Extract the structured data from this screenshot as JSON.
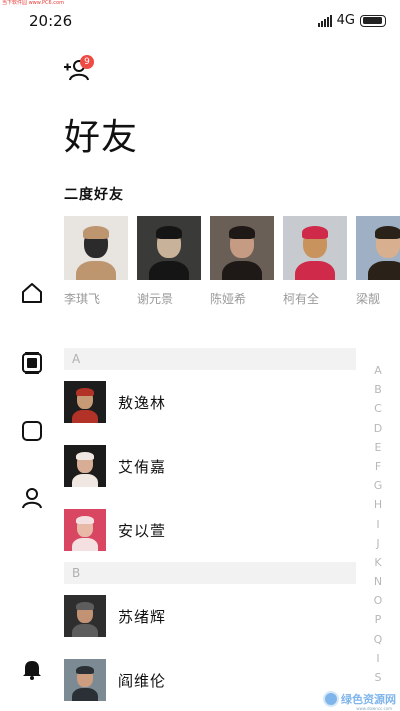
{
  "watermark_top": "当下软件园 www.PC6.com",
  "status_bar": {
    "time": "20:26",
    "network": "4G",
    "network_sub": "ℹ",
    "battery_level": 0.95
  },
  "header": {
    "add_friend_icon": "add-person-icon",
    "badge_count": "9",
    "title": "好友"
  },
  "second_degree": {
    "title": "二度好友",
    "people": [
      {
        "name": "李琪飞",
        "photo_colors": [
          "#e8e5e0",
          "#2b2b2b",
          "#bd9670"
        ]
      },
      {
        "name": "谢元景",
        "photo_colors": [
          "#3a3a38",
          "#c9b29a",
          "#151515"
        ]
      },
      {
        "name": "陈娅希",
        "photo_colors": [
          "#6a5f57",
          "#c59b84",
          "#1e1916"
        ]
      },
      {
        "name": "柯有全",
        "photo_colors": [
          "#c7cbcf",
          "#c9935e",
          "#cf2a4a"
        ]
      },
      {
        "name": "梁靓",
        "photo_colors": [
          "#9fb0c4",
          "#d9b08f",
          "#2a2118"
        ]
      }
    ]
  },
  "nav": {
    "items": [
      {
        "icon": "home-icon"
      },
      {
        "icon": "feed-icon"
      },
      {
        "icon": "square-icon"
      },
      {
        "icon": "person-icon"
      },
      {
        "icon": "bell-icon"
      }
    ]
  },
  "contacts": {
    "sections": [
      {
        "letter": "A",
        "items": [
          {
            "name": "敖逸林",
            "photo_colors": [
              "#1d1d1d",
              "#c79a76",
              "#b23228"
            ]
          },
          {
            "name": "艾侑嘉",
            "photo_colors": [
              "#1b1b1b",
              "#d7ad96",
              "#f0e6e2"
            ]
          },
          {
            "name": "安以萱",
            "photo_colors": [
              "#d94661",
              "#e8b9a6",
              "#f4e0e0"
            ]
          }
        ]
      },
      {
        "letter": "B",
        "items": [
          {
            "name": "苏绪辉",
            "photo_colors": [
              "#2e2e2e",
              "#c29274",
              "#5d5d5d"
            ]
          },
          {
            "name": "阎维伦",
            "photo_colors": [
              "#7b8a93",
              "#cc9d7f",
              "#2a3036"
            ]
          }
        ]
      }
    ]
  },
  "alphabet_index": [
    "A",
    "B",
    "C",
    "D",
    "E",
    "F",
    "G",
    "H",
    "I",
    "J",
    "K",
    "N",
    "O",
    "P",
    "Q",
    "I",
    "S"
  ],
  "watermark_badge": {
    "text": "绿色资源网",
    "sub": "www.downcc.com"
  }
}
